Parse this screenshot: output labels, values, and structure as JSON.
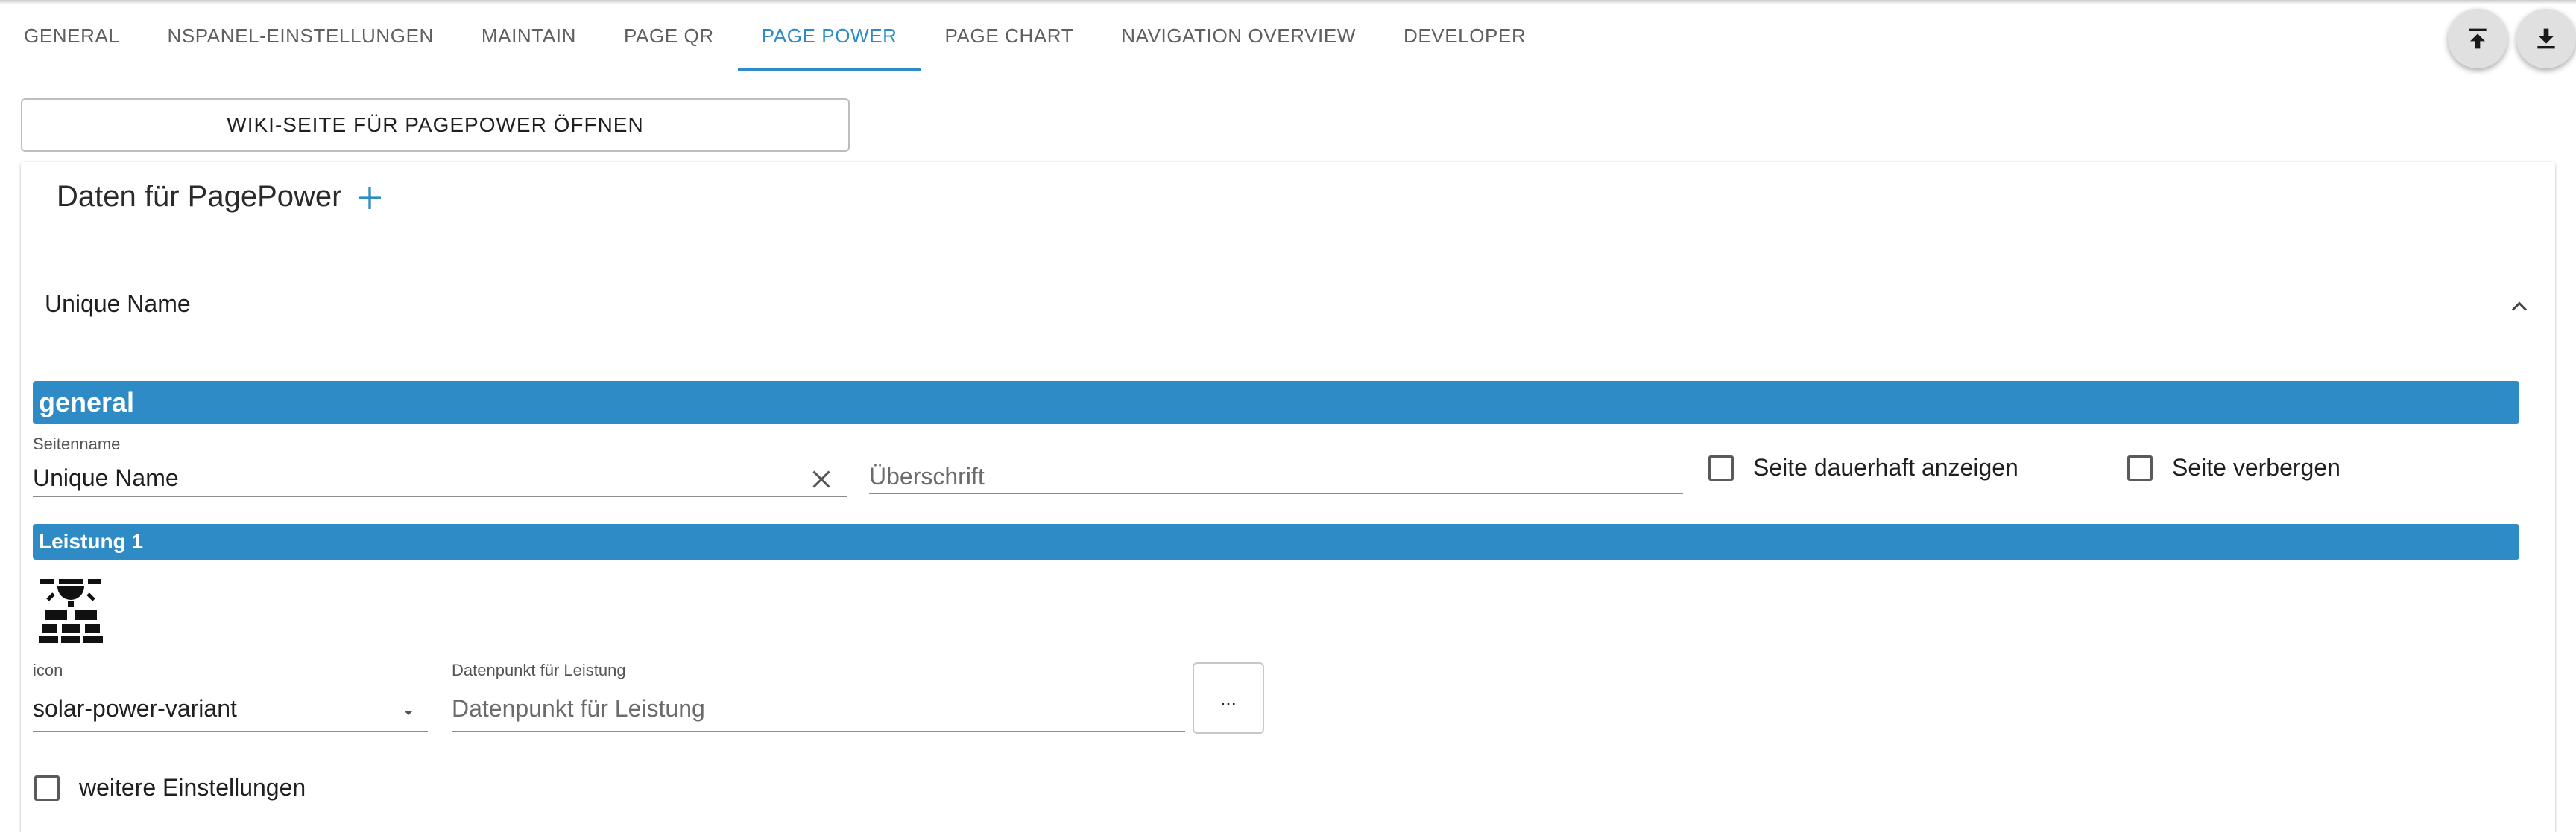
{
  "tabs": [
    {
      "label": "General",
      "active": false
    },
    {
      "label": "NSPanel-Einstellungen",
      "active": false
    },
    {
      "label": "Maintain",
      "active": false
    },
    {
      "label": "Page QR",
      "active": false
    },
    {
      "label": "Page Power",
      "active": true
    },
    {
      "label": "Page Chart",
      "active": false
    },
    {
      "label": "Navigation Overview",
      "active": false
    },
    {
      "label": "Developer",
      "active": false
    }
  ],
  "toolbar": {
    "upload_icon": "upload-icon",
    "download_icon": "download-icon"
  },
  "wiki_button": {
    "label": "WIKI-SEITE FÜR PAGEPOWER ÖFFNEN"
  },
  "card": {
    "title": "Daten für PagePower",
    "add_icon": "plus-icon",
    "accordion": {
      "title": "Unique Name",
      "expanded": true
    },
    "general": {
      "heading": "general",
      "page_name": {
        "label": "Seitenname",
        "value": "Unique Name"
      },
      "headline": {
        "placeholder": "Überschrift",
        "value": ""
      },
      "show_permanent": {
        "label": "Seite dauerhaft anzeigen",
        "checked": false
      },
      "hide_page": {
        "label": "Seite verbergen",
        "checked": false
      }
    },
    "leistung1": {
      "heading": "Leistung 1",
      "icon_preview": "solar-power-variant-icon",
      "icon_select": {
        "label": "icon",
        "value": "solar-power-variant"
      },
      "datapoint": {
        "label": "Datenpunkt für Leistung",
        "placeholder": "Datenpunkt für Leistung",
        "value": ""
      },
      "browse_button": {
        "label": "..."
      },
      "more_settings": {
        "label": "weitere Einstellungen",
        "checked": false
      }
    }
  },
  "colors": {
    "accent": "#2f8bc6",
    "section_bar": "#2f8bc6",
    "fab_background": "#e0e0e0"
  }
}
